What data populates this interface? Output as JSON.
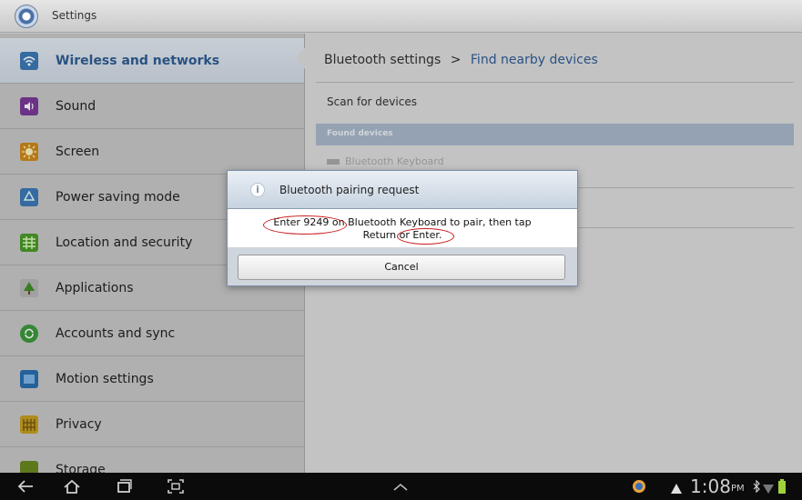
{
  "titlebar": {
    "title": "Settings",
    "icon": "settings-gear-icon"
  },
  "sidebar": {
    "items": [
      {
        "label": "Wireless and networks",
        "icon": "wifi-icon",
        "color": "#3d7ab8",
        "selected": true
      },
      {
        "label": "Sound",
        "icon": "speaker-icon",
        "color": "#7a3a9a"
      },
      {
        "label": "Screen",
        "icon": "brightness-icon",
        "color": "#d08a1c"
      },
      {
        "label": "Power saving mode",
        "icon": "recycle-icon",
        "color": "#3d7ab8"
      },
      {
        "label": "Location and security",
        "icon": "grid-icon",
        "color": "#4c9a2a"
      },
      {
        "label": "Applications",
        "icon": "tree-icon",
        "color": "#4c9a2a"
      },
      {
        "label": "Accounts and sync",
        "icon": "sync-icon",
        "color": "#3c9a3c"
      },
      {
        "label": "Motion settings",
        "icon": "motion-icon",
        "color": "#2a6fb0"
      },
      {
        "label": "Privacy",
        "icon": "fence-icon",
        "color": "#c8a020"
      },
      {
        "label": "Storage",
        "icon": "storage-icon",
        "color": "#6a8a20"
      }
    ]
  },
  "main": {
    "breadcrumb": {
      "parent": "Bluetooth settings",
      "separator": ">",
      "current": "Find nearby devices"
    },
    "scan_label": "Scan for devices",
    "found_header": "Found devices",
    "device": "Bluetooth Keyboard"
  },
  "dialog": {
    "title": "Bluetooth pairing request",
    "message_line1": "Enter 9249 on Bluetooth Keyboard to pair, then tap",
    "message_line2": "Return or Enter.",
    "cancel_label": "Cancel"
  },
  "statusbar": {
    "time": "1:08",
    "ampm": "PM",
    "nav": [
      "back-icon",
      "home-icon",
      "recent-apps-icon",
      "screenshot-icon"
    ],
    "tray": [
      "browser-icon",
      "warning-icon",
      "bluetooth-icon",
      "wifi-signal-icon",
      "battery-icon"
    ]
  },
  "colors": {
    "accent": "#2e5d96",
    "annotation": "#c8191d",
    "found_header_bg": "#a9b9cc"
  }
}
